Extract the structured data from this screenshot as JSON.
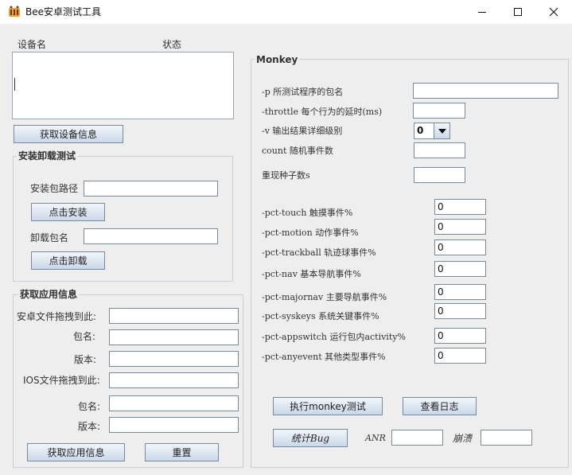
{
  "window": {
    "title": "Bee安卓测试工具",
    "icon": "bee-app-icon",
    "controls": [
      "minimize-icon",
      "maximize-icon",
      "close-icon"
    ]
  },
  "devices": {
    "col_name": "设备名",
    "col_status": "状态",
    "get_button": "获取设备信息"
  },
  "install": {
    "title": "安装卸载测试",
    "apk_path_label": "安装包路径",
    "apk_path_value": "",
    "install_button": "点击安装",
    "uninstall_label": "卸载包名",
    "uninstall_value": "",
    "uninstall_button": "点击卸载"
  },
  "appinfo": {
    "title": "获取应用信息",
    "android_drop_label": "安卓文件拖拽到此:",
    "android_pkg_label": "包名:",
    "android_version_label": "版本:",
    "ios_drop_label": "IOS文件拖拽到此:",
    "ios_pkg_label": "包名:",
    "ios_version_label": "版本:",
    "get_button": "获取应用信息",
    "reset_button": "重置"
  },
  "monkey": {
    "title": "Monkey",
    "p_label": "-p 所测试程序的包名",
    "p_value": "",
    "throttle_label": "-throttle 每个行为的延时(ms)",
    "throttle_value": "",
    "v_label": "-v 输出结果详细级别",
    "v_value": "0",
    "count_label": "count 随机事件数",
    "count_value": "",
    "seed_label": "重现种子数s",
    "seed_value": "",
    "pct": [
      {
        "label": "-pct-touch 触摸事件%",
        "value": "0"
      },
      {
        "label": "-pct-motion 动作事件%",
        "value": "0"
      },
      {
        "label": "-pct-trackball 轨迹球事件%",
        "value": "0"
      },
      {
        "label": "-pct-nav 基本导航事件%",
        "value": "0"
      },
      {
        "label": "-pct-majornav 主要导航事件%",
        "value": "0"
      },
      {
        "label": "-pct-syskeys 系统关键事件%",
        "value": "0"
      },
      {
        "label": "-pct-appswitch 运行包内activity%",
        "value": "0"
      },
      {
        "label": "-pct-anyevent 其他类型事件%",
        "value": "0"
      }
    ],
    "run_button": "执行monkey测试",
    "log_button": "查看日志",
    "bug_button": "统计Bug",
    "anr_label": "ANR",
    "anr_value": "",
    "crash_label": "崩溃",
    "crash_value": ""
  }
}
